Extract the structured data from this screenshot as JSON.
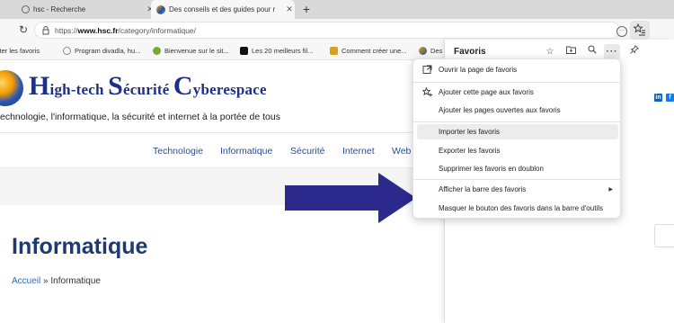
{
  "tabs": [
    {
      "label": "hsc - Recherche",
      "favicon": "search-icon",
      "active": false
    },
    {
      "label": "Des conseils et des guides pour r",
      "favicon": "hsc-globe-icon",
      "active": true
    }
  ],
  "new_tab_label": "+",
  "address": {
    "prefix": "https://",
    "domain": "www.hsc.fr",
    "path": "/category/informatique/"
  },
  "bookmarks": [
    {
      "label": "rter les favoris",
      "icon": "import-icon",
      "color": "#777777"
    },
    {
      "label": "Program divadla, hu...",
      "icon": "theatre-icon",
      "color": "#888888"
    },
    {
      "label": "Bienvenue sur le sit...",
      "icon": "site-icon",
      "color": "#7aa83a"
    },
    {
      "label": "Les 20 meilleurs fil...",
      "icon": "film-icon",
      "color": "#111111"
    },
    {
      "label": "Comment créer une...",
      "icon": "cm-icon",
      "color": "#d7a21a"
    },
    {
      "label": "Des",
      "icon": "hsc-globe-icon",
      "color": "#1e4fa8"
    }
  ],
  "site": {
    "logo": {
      "h": "H",
      "rest1": "igh-tech ",
      "s": "S",
      "rest2": "écurité ",
      "c": "C",
      "rest3": "yberespace"
    },
    "tagline": "echnologie, l'informatique, la sécurité et internet à la portée de tous",
    "nav": [
      "Technologie",
      "Informatique",
      "Sécurité",
      "Internet",
      "Web"
    ],
    "page_title": "Informatique",
    "breadcrumb": {
      "home": "Accueil",
      "sep": " » ",
      "current": "Informatique"
    },
    "social": [
      {
        "label": "in",
        "color": "#0a66c2"
      },
      {
        "label": "f",
        "color": "#1877f2"
      }
    ]
  },
  "favorites_panel": {
    "title": "Favoris",
    "header_buttons": [
      "add-favorite-icon",
      "add-folder-icon",
      "search-icon",
      "more-icon",
      "pin-icon"
    ]
  },
  "menu": {
    "items": [
      {
        "label": "Ouvrir la page de favoris",
        "icon": "open-page-icon"
      },
      {
        "label": "Ajouter cette page aux favoris",
        "icon": "add-favorite-icon"
      },
      {
        "label": "Ajouter les pages ouvertes aux favoris",
        "icon": ""
      },
      {
        "label": "Importer les favoris",
        "icon": "",
        "highlighted": true
      },
      {
        "label": "Exporter les favoris",
        "icon": ""
      },
      {
        "label": "Supprimer les favoris en doublon",
        "icon": ""
      },
      {
        "label": "Afficher la barre des favoris",
        "icon": "",
        "submenu": true
      },
      {
        "label": "Masquer le bouton des favoris dans la barre d'outils",
        "icon": ""
      }
    ]
  },
  "colors": {
    "accent": "#1a6fd6",
    "arrow": "#2b2a8c",
    "logo": "#1d2f87",
    "nav": "#2e4e8c"
  }
}
